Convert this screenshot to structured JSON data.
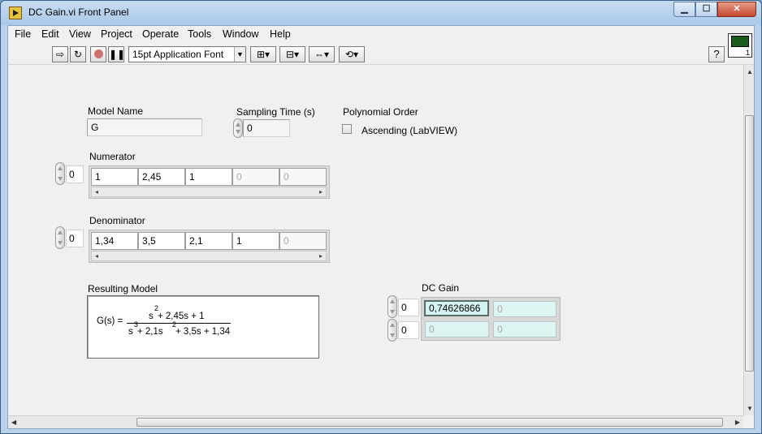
{
  "window": {
    "title": "DC Gain.vi Front Panel"
  },
  "menu": [
    "File",
    "Edit",
    "View",
    "Project",
    "Operate",
    "Tools",
    "Window",
    "Help"
  ],
  "toolbar": {
    "font": "15pt Application Font",
    "help": "?"
  },
  "vi_icon": {
    "number": "1"
  },
  "model_name": {
    "label": "Model Name",
    "value": "G"
  },
  "sampling_time": {
    "label": "Sampling Time (s)",
    "value": "0"
  },
  "polynomial_order": {
    "label": "Polynomial Order",
    "checkbox_label": "Ascending (LabVIEW)",
    "checked": false
  },
  "numerator": {
    "label": "Numerator",
    "index": "0",
    "values": [
      "1",
      "2,45",
      "1",
      "0",
      "0"
    ]
  },
  "denominator": {
    "label": "Denominator",
    "index": "0",
    "values": [
      "1,34",
      "3,5",
      "2,1",
      "1",
      "0"
    ]
  },
  "resulting_model": {
    "label": "Resulting Model",
    "lhs": "G(s) =",
    "num_a": "s",
    "num_a_exp": "2",
    "num_b": " + 2,45s + 1",
    "den_a": "s",
    "den_a_exp": "3",
    "den_b": " + 2,1s",
    "den_b_exp": "2",
    "den_c": " + 3,5s + 1,34"
  },
  "dc_gain": {
    "label": "DC Gain",
    "row_index": "0",
    "col_index": "0",
    "rows": [
      [
        "0,74626866",
        "0"
      ],
      [
        "0",
        "0"
      ]
    ]
  }
}
